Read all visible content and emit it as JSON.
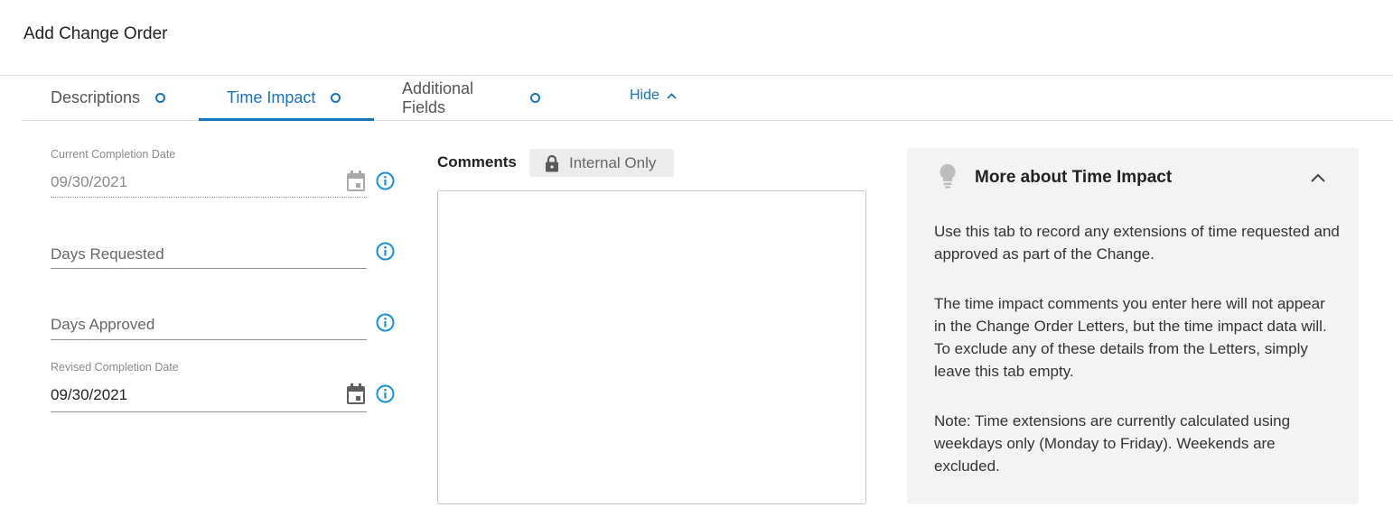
{
  "page": {
    "title": "Add Change Order"
  },
  "tabs": [
    {
      "label": "Descriptions",
      "active": false
    },
    {
      "label": "Time Impact",
      "active": true
    },
    {
      "label": "Additional Fields",
      "active": false
    }
  ],
  "hide_toggle": {
    "label": "Hide",
    "icon": "chevron-up-icon"
  },
  "fields": {
    "current_completion": {
      "label": "Current Completion Date",
      "value": "09/30/2021",
      "disabled": true,
      "icon": "calendar-icon"
    },
    "days_requested": {
      "placeholder": "Days Requested"
    },
    "days_approved": {
      "placeholder": "Days Approved"
    },
    "revised_completion": {
      "label": "Revised Completion Date",
      "value": "09/30/2021",
      "icon": "calendar-icon"
    }
  },
  "comments": {
    "label": "Comments",
    "chip_label": "Internal Only",
    "chip_icon": "lock-icon",
    "value": ""
  },
  "info_panel": {
    "title": "More about Time Impact",
    "icon": "lightbulb-icon",
    "paragraphs": [
      "Use this tab to record any extensions of time requested and approved as part of the Change.",
      "The time impact comments you enter here will not appear in the Change Order Letters, but the time impact data will. To exclude any of these details from the Letters, simply leave this tab empty.",
      "Note: Time extensions are currently calculated using weekdays only (Monday to Friday). Weekends are excluded."
    ]
  },
  "colors": {
    "accent": "#1a73b8",
    "panel_bg": "#f3f3f3",
    "chip_bg": "#ececec"
  }
}
